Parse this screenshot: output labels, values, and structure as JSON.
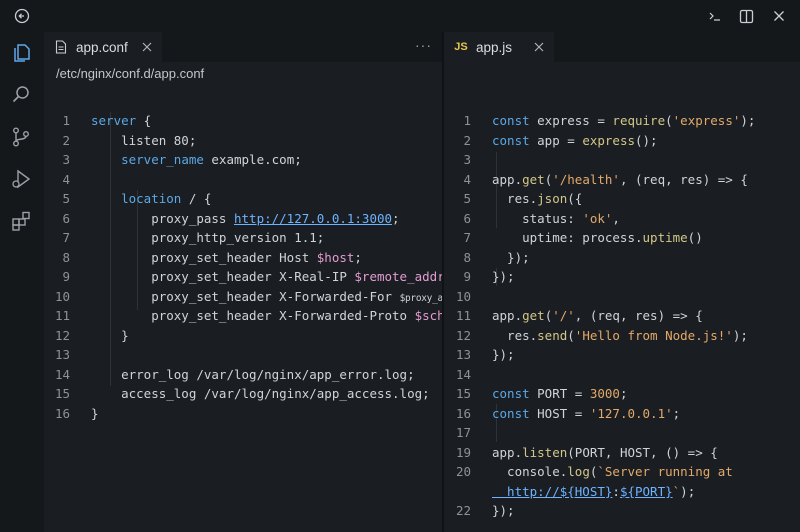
{
  "window": {
    "icons": [
      "back-icon",
      "minimize-icon",
      "split-layout-icon",
      "close-icon"
    ]
  },
  "activity_bar": {
    "items": [
      "explorer-icon",
      "search-icon",
      "source-control-icon",
      "run-debug-icon",
      "extensions-icon"
    ]
  },
  "left_editor": {
    "tab": {
      "name": "app.conf",
      "icon": "file-icon"
    },
    "more_label": "···",
    "breadcrumb": "/etc/nginx/conf.d/app.conf",
    "lines": [
      {
        "n": "1",
        "t": "server {"
      },
      {
        "n": "2",
        "t": "    listen 80;"
      },
      {
        "n": "3",
        "t": "    server_name example.com;"
      },
      {
        "n": "4",
        "t": ""
      },
      {
        "n": "5",
        "t": "    location / {"
      },
      {
        "n": "6",
        "t": "        proxy_pass ",
        "u": "http://127.0.0.1:3000",
        "t2": ";"
      },
      {
        "n": "7",
        "t": "        proxy_http_version 1.1;"
      },
      {
        "n": "8",
        "t": "        proxy_set_header Host ",
        "v": "$host",
        "t2": ";"
      },
      {
        "n": "9",
        "t": "        proxy_set_header X-Real-IP ",
        "v": "$remote_addr",
        "t2": ";"
      },
      {
        "n": "10",
        "t": "        proxy_set_header X-Forwarded-For ",
        "s": "$proxy_add_x_forwarded_for;"
      },
      {
        "n": "11",
        "t": "        proxy_set_header X-Forwarded-Proto ",
        "v": "$scheme",
        "t2": ";"
      },
      {
        "n": "12",
        "t": "    }"
      },
      {
        "n": "13",
        "t": ""
      },
      {
        "n": "14",
        "t": "    error_log /var/log/nginx/app_error.log;"
      },
      {
        "n": "15",
        "t": "    access_log /var/log/nginx/app_access.log;"
      },
      {
        "n": "16",
        "t": "}"
      }
    ]
  },
  "right_editor": {
    "tab": {
      "badge": "JS",
      "name": "app.js"
    },
    "lines": [
      {
        "n": "1",
        "p": [
          [
            "kw",
            "const"
          ],
          [
            "",
            "express = "
          ],
          [
            "fn",
            "require"
          ],
          [
            "",
            "("
          ],
          [
            "str",
            "'express'"
          ],
          [
            "",
            ");"
          ]
        ]
      },
      {
        "n": "2",
        "p": [
          [
            "kw",
            "const"
          ],
          [
            "",
            "app = "
          ],
          [
            "fn",
            "express"
          ],
          [
            "",
            "();"
          ]
        ]
      },
      {
        "n": "3",
        "p": []
      },
      {
        "n": "4",
        "p": [
          [
            "",
            "app."
          ],
          [
            "fn",
            "get"
          ],
          [
            "",
            "("
          ],
          [
            "str",
            "'/health'"
          ],
          [
            "",
            ", (req, res) => {"
          ]
        ]
      },
      {
        "n": "5",
        "p": [
          [
            "",
            "  res."
          ],
          [
            "fn",
            "json"
          ],
          [
            "",
            "({"
          ]
        ]
      },
      {
        "n": "6",
        "p": [
          [
            "",
            "    status: "
          ],
          [
            "str",
            "'ok'"
          ],
          [
            "",
            ","
          ]
        ]
      },
      {
        "n": "7",
        "p": [
          [
            "",
            "    uptime: process."
          ],
          [
            "fn",
            "uptime"
          ],
          [
            "",
            "()"
          ]
        ]
      },
      {
        "n": "8",
        "p": [
          [
            "",
            "  });"
          ]
        ]
      },
      {
        "n": "9",
        "p": [
          [
            "",
            "});"
          ]
        ]
      },
      {
        "n": "10",
        "p": []
      },
      {
        "n": "11",
        "p": [
          [
            "",
            "app."
          ],
          [
            "fn",
            "get"
          ],
          [
            "",
            "("
          ],
          [
            "str",
            "'/'"
          ],
          [
            "",
            ", (req, res) => {"
          ]
        ]
      },
      {
        "n": "12",
        "p": [
          [
            "",
            "  res."
          ],
          [
            "fn",
            "send"
          ],
          [
            "",
            "("
          ],
          [
            "str",
            "'Hello from Node.js!'"
          ],
          [
            "",
            ");"
          ]
        ]
      },
      {
        "n": "13",
        "p": [
          [
            "",
            "});"
          ]
        ]
      },
      {
        "n": "14",
        "p": []
      },
      {
        "n": "15",
        "p": [
          [
            "kw",
            "const"
          ],
          [
            "",
            "PORT = "
          ],
          [
            "str",
            "3000"
          ],
          [
            "",
            ";"
          ]
        ]
      },
      {
        "n": "16",
        "p": [
          [
            "kw",
            "const"
          ],
          [
            "",
            "HOST = "
          ],
          [
            "str",
            "'127.0.0.1'"
          ],
          [
            "",
            ";"
          ]
        ]
      },
      {
        "n": "17",
        "p": []
      },
      {
        "n": "19",
        "p": [
          [
            "",
            "app."
          ],
          [
            "fn",
            "listen"
          ],
          [
            "",
            "(PORT, HOST, () => {"
          ]
        ]
      },
      {
        "n": "20",
        "p": [
          [
            "",
            "  console."
          ],
          [
            "fn",
            "log"
          ],
          [
            "",
            "("
          ],
          [
            "str",
            "`Server running at"
          ]
        ]
      },
      {
        "n": "",
        "p": [
          [
            "url",
            "  http://${HOST}"
          ],
          [
            "",
            ":"
          ],
          [
            "url",
            "${PORT}"
          ],
          [
            "str",
            "`"
          ],
          [
            "",
            ");"
          ]
        ]
      },
      {
        "n": "22",
        "p": [
          [
            "",
            "});"
          ]
        ]
      }
    ]
  }
}
